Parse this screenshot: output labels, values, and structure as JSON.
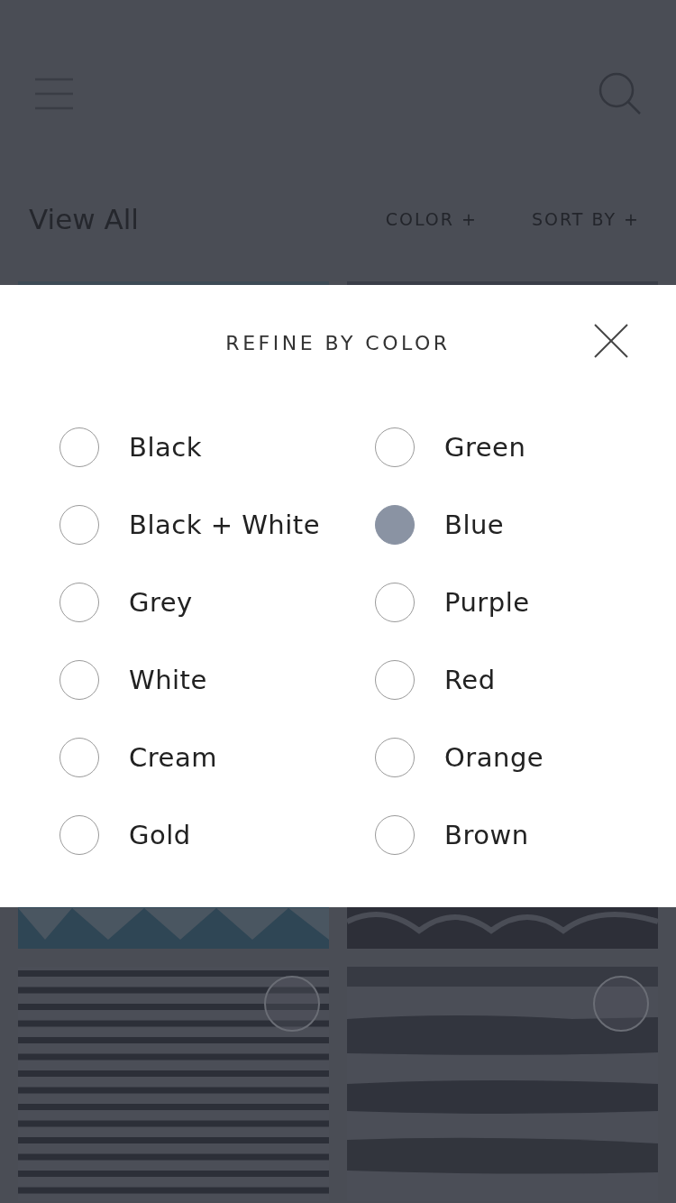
{
  "header": {
    "view_all": "View All",
    "filters": [
      "COLOR +",
      "SORT BY +"
    ]
  },
  "modal": {
    "title": "REFINE BY COLOR",
    "columns": [
      [
        {
          "label": "Black",
          "selected": false
        },
        {
          "label": "Black + White",
          "selected": false
        },
        {
          "label": "Grey",
          "selected": false
        },
        {
          "label": "White",
          "selected": false
        },
        {
          "label": "Cream",
          "selected": false
        },
        {
          "label": "Gold",
          "selected": false
        }
      ],
      [
        {
          "label": "Green",
          "selected": false
        },
        {
          "label": "Blue",
          "selected": true
        },
        {
          "label": "Purple",
          "selected": false
        },
        {
          "label": "Red",
          "selected": false
        },
        {
          "label": "Orange",
          "selected": false
        },
        {
          "label": "Brown",
          "selected": false
        }
      ]
    ]
  }
}
